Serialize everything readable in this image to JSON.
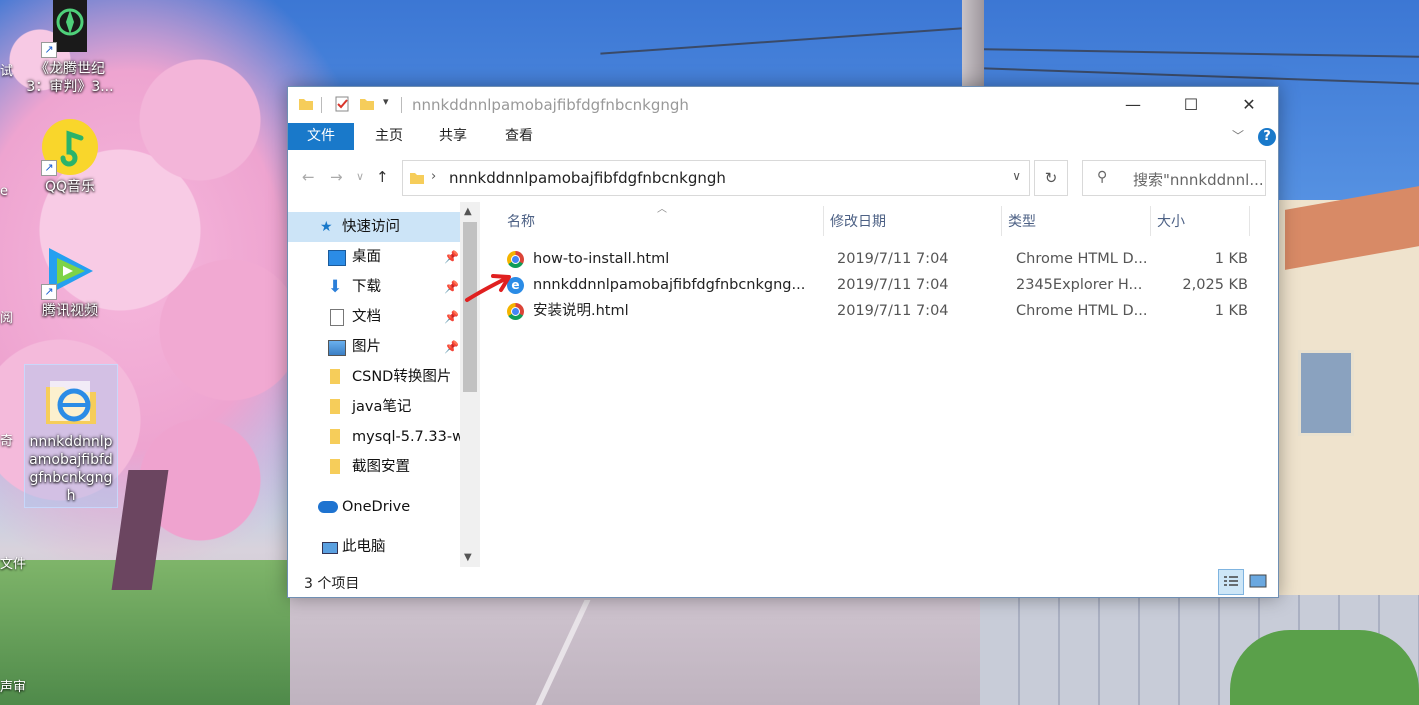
{
  "desktop": {
    "icons": [
      {
        "label": "《龙腾世纪3：审判》3...",
        "icon": "game-icon"
      },
      {
        "label": "QQ音乐",
        "icon": "music-icon"
      },
      {
        "label": "腾讯视频",
        "icon": "video-icon"
      },
      {
        "label": "nnnkddnnlpamobajfibfdgfnbcnkgngh",
        "icon": "folder-ie-icon"
      }
    ],
    "edge_labels": [
      "试",
      "e",
      "阅",
      "奇",
      "文件",
      "声审"
    ]
  },
  "window": {
    "title": "nnnkddnnlpamobajfibfdgfnbcnkgngh",
    "caption_buttons": {
      "minimize": "—",
      "maximize": "☐",
      "close": "✕"
    },
    "ribbon_tabs": [
      "文件",
      "主页",
      "共享",
      "查看"
    ],
    "help": "?",
    "address": {
      "path": "nnnkddnnlpamobajfibfdgfnbcnkgngh"
    },
    "search": {
      "placeholder": "搜索\"nnnkddnnl..."
    },
    "nav_items": [
      {
        "label": "快速访问",
        "icon": "star-icon",
        "pinned": false,
        "active": true
      },
      {
        "label": "桌面",
        "icon": "desktop-icon",
        "pinned": true
      },
      {
        "label": "下载",
        "icon": "download-icon",
        "pinned": true
      },
      {
        "label": "文档",
        "icon": "document-icon",
        "pinned": true
      },
      {
        "label": "图片",
        "icon": "picture-icon",
        "pinned": true
      },
      {
        "label": "CSND转换图片",
        "icon": "folder-icon",
        "pinned": false
      },
      {
        "label": "java笔记",
        "icon": "folder-icon",
        "pinned": false
      },
      {
        "label": "mysql-5.7.33-w",
        "icon": "folder-icon",
        "pinned": false
      },
      {
        "label": "截图安置",
        "icon": "folder-icon",
        "pinned": false
      },
      {
        "label": "OneDrive",
        "icon": "cloud-icon",
        "pinned": false
      },
      {
        "label": "此电脑",
        "icon": "computer-icon",
        "pinned": false
      }
    ],
    "columns": [
      "名称",
      "修改日期",
      "类型",
      "大小"
    ],
    "files": [
      {
        "name": "how-to-install.html",
        "date": "2019/7/11 7:04",
        "type": "Chrome HTML D...",
        "size": "1 KB",
        "icon": "chrome-icon"
      },
      {
        "name": "nnnkddnnlpamobajfibfdgfnbcnkgng...",
        "date": "2019/7/11 7:04",
        "type": "2345Explorer H...",
        "size": "2,025 KB",
        "icon": "ie-icon"
      },
      {
        "name": "安装说明.html",
        "date": "2019/7/11 7:04",
        "type": "Chrome HTML D...",
        "size": "1 KB",
        "icon": "chrome-icon"
      }
    ],
    "status": "3 个项目"
  },
  "colors": {
    "accent": "#1979ca",
    "selection": "#cce4f7",
    "annotation_arrow": "#e02020"
  }
}
